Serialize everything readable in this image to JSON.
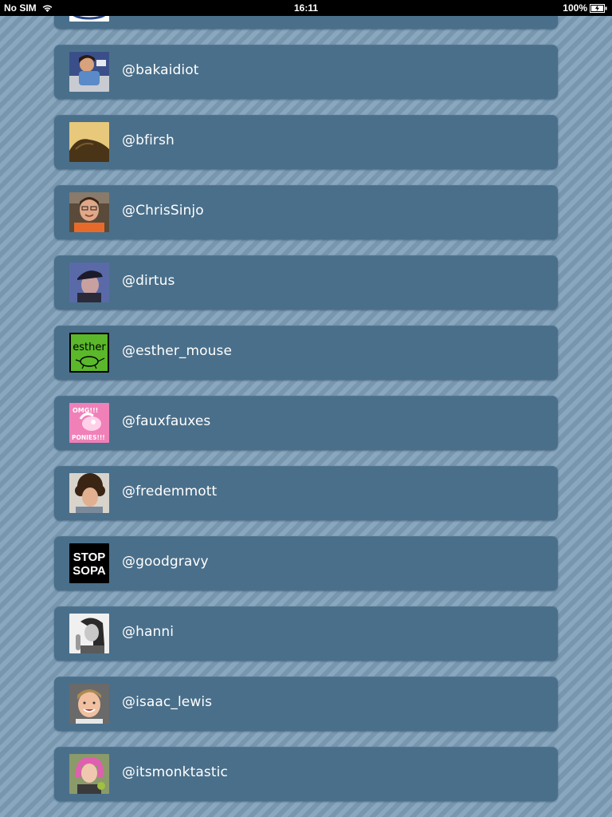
{
  "status_bar": {
    "carrier": "No SIM",
    "time": "16:11",
    "battery": "100%"
  },
  "users": [
    {
      "handle": "",
      "avatar": "partial-logo-avatar"
    },
    {
      "handle": "@bakaidiot",
      "avatar": "person-photo-avatar"
    },
    {
      "handle": "@bfirsh",
      "avatar": "hair-closeup-avatar"
    },
    {
      "handle": "@ChrisSinjo",
      "avatar": "smiling-man-avatar"
    },
    {
      "handle": "@dirtus",
      "avatar": "man-with-cap-avatar"
    },
    {
      "handle": "@esther_mouse",
      "avatar": "green-esther-logo-avatar",
      "avatar_text": "esther"
    },
    {
      "handle": "@fauxfauxes",
      "avatar": "pink-omg-ponies-avatar",
      "avatar_text_top": "OMG!!!",
      "avatar_text_bottom": "PONIES!!!"
    },
    {
      "handle": "@fredemmott",
      "avatar": "curly-hair-man-avatar"
    },
    {
      "handle": "@goodgravy",
      "avatar": "stop-sopa-avatar",
      "avatar_text_top": "STOP",
      "avatar_text_bottom": "SOPA"
    },
    {
      "handle": "@hanni",
      "avatar": "black-white-woman-avatar"
    },
    {
      "handle": "@isaac_lewis",
      "avatar": "smiling-young-man-avatar"
    },
    {
      "handle": "@itsmonktastic",
      "avatar": "pink-hair-woman-avatar"
    }
  ]
}
